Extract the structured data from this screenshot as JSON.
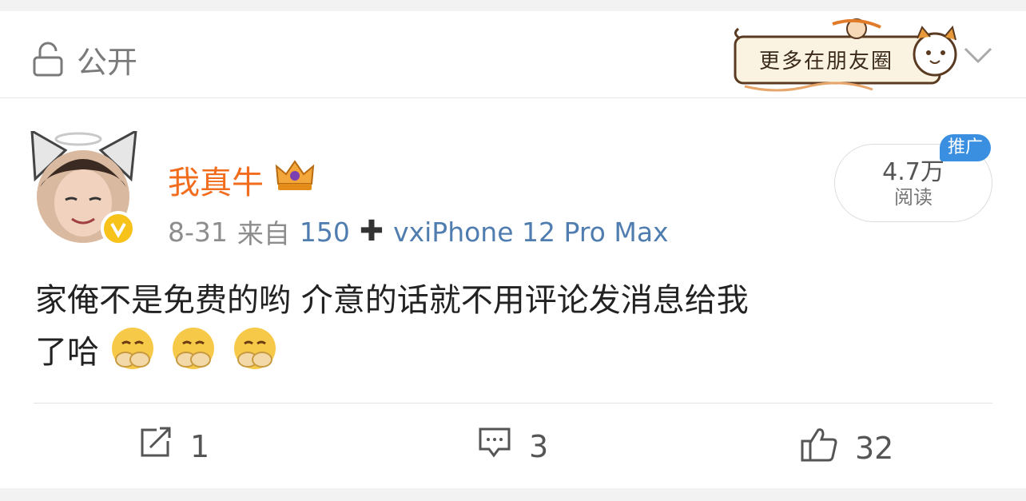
{
  "header": {
    "privacy_label": "公开",
    "banner_text": "更多在朋友圈"
  },
  "post": {
    "username": "我真牛",
    "date": "8-31",
    "from_label": "来自",
    "source_a": "150",
    "source_b": "vxiPhone 12 Pro Max",
    "reads_count": "4.7万",
    "reads_label": "阅读",
    "promo_badge": "推广",
    "content_line1": "家俺不是免费的哟 介意的话就不用评论发消息给我",
    "content_line2": "了哈",
    "emoji": [
      "face-covering-mouth",
      "face-covering-mouth",
      "face-covering-mouth"
    ]
  },
  "actions": {
    "repost_count": "1",
    "comment_count": "3",
    "like_count": "32"
  },
  "colors": {
    "username": "#f26c1e",
    "source_link": "#507daf",
    "promo": "#3a8fe0",
    "verified": "#f7c21a"
  }
}
